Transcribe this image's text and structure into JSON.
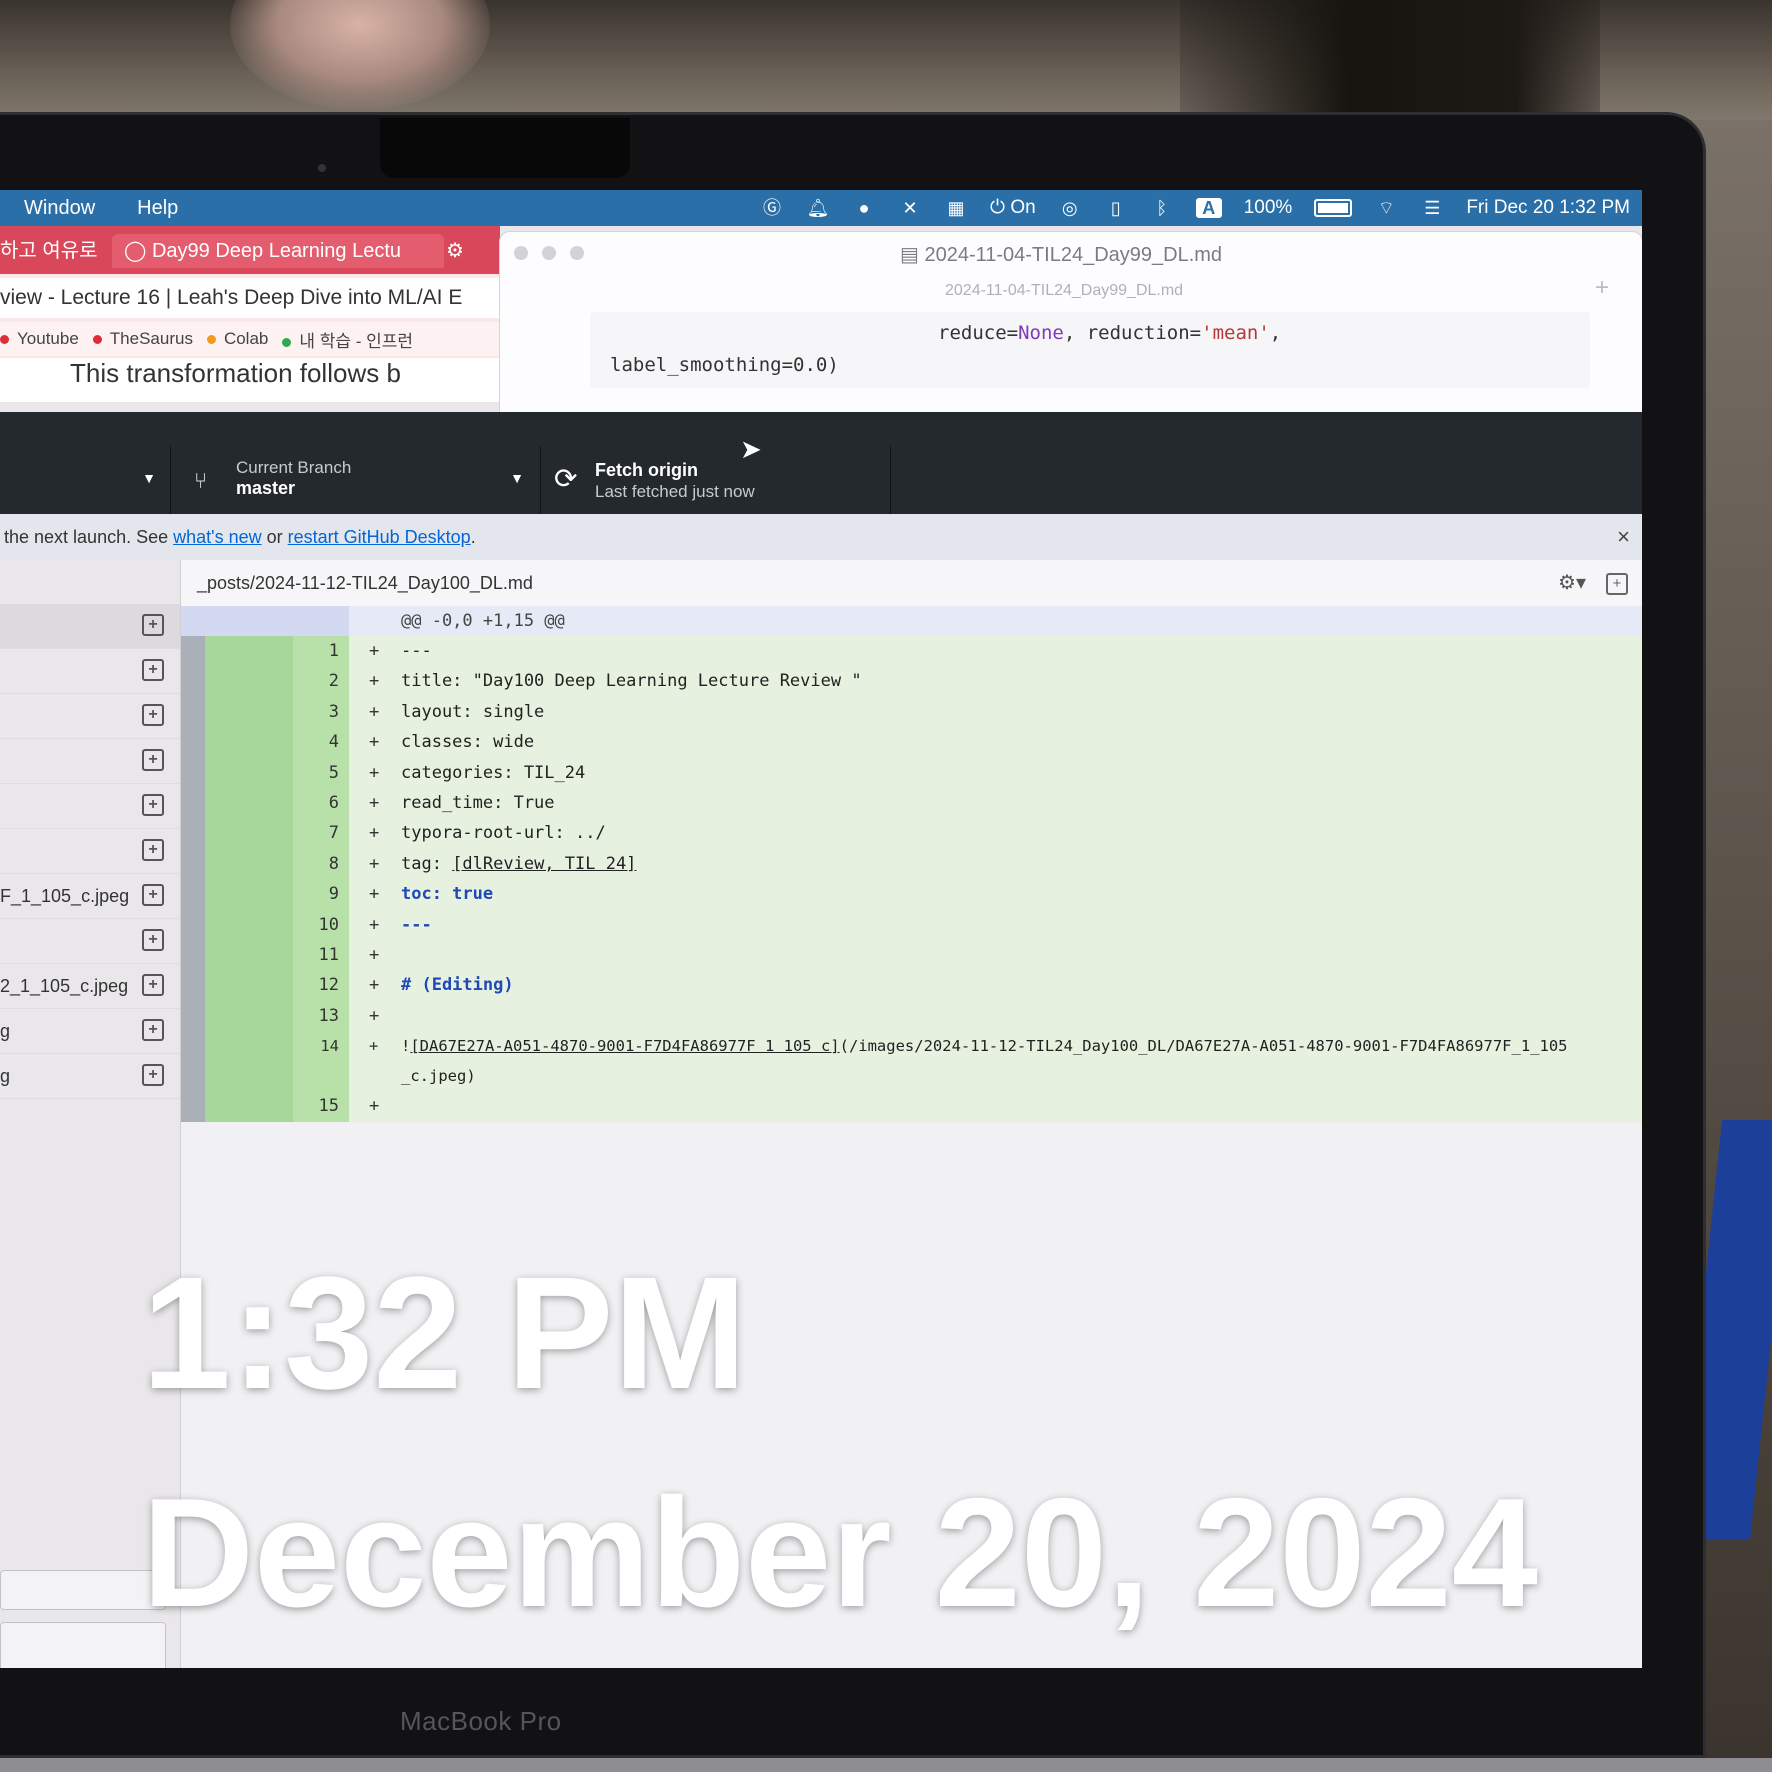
{
  "menubar": {
    "items": [
      "Window",
      "Help"
    ],
    "status": {
      "focus_label": "On",
      "input_source": "A",
      "battery": "100%",
      "datetime": "Fri Dec 20  1:32 PM"
    }
  },
  "browser": {
    "tabs": [
      "하고 여유로",
      "Day99 Deep Learning Lectu"
    ],
    "page_title": "view - Lecture 16 | Leah's Deep Dive into ML/AI E",
    "bookmarks": [
      {
        "label": "Youtube",
        "color": "#e02b3a"
      },
      {
        "label": "TheSaurus",
        "color": "#e02b3a"
      },
      {
        "label": "Colab",
        "color": "#f29a1f"
      },
      {
        "label": "내 학습 - 인프런",
        "color": "#2fa84f"
      }
    ],
    "body_text": "This transformation follows b"
  },
  "typora": {
    "title": "2024-11-04-TIL24_Day99_DL.md",
    "subtitle": "2024-11-04-TIL24_Day99_DL.md",
    "code_line1_a": "reduce=",
    "code_line1_b": "None",
    "code_line1_c": ", reduction=",
    "code_line1_d": "'mean'",
    "code_line1_e": ",",
    "code_line2": "label_smoothing=0.0)"
  },
  "github": {
    "current_branch_label": "Current Branch",
    "current_branch": "master",
    "fetch_label": "Fetch origin",
    "fetch_sub": "Last fetched just now",
    "banner_prefix": "the next launch. See ",
    "banner_link1": "what's new",
    "banner_mid": " or ",
    "banner_link2": "restart GitHub Desktop",
    "banner_suffix": ".",
    "file_path": "_posts/2024-11-12-TIL24_Day100_DL.md",
    "hunk_header": "@@ -0,0 +1,15 @@",
    "sidebar_files": [
      "",
      "",
      "",
      "",
      "",
      "",
      "F_1_105_c.jpeg",
      "",
      "2_1_105_c.jpeg",
      "g",
      "g"
    ],
    "diff_lines": [
      {
        "n": "1",
        "text": "---"
      },
      {
        "n": "2",
        "text": "title: \"Day100 Deep Learning Lecture Review \""
      },
      {
        "n": "3",
        "text": "layout: single"
      },
      {
        "n": "4",
        "text": "classes: wide"
      },
      {
        "n": "5",
        "text": "categories: TIL_24"
      },
      {
        "n": "6",
        "text": "read_time: True"
      },
      {
        "n": "7",
        "text": "typora-root-url: ../"
      },
      {
        "n": "8",
        "text_a": "tag: ",
        "link": "[dlReview, TIL 24]"
      },
      {
        "n": "9",
        "kw": "toc: true"
      },
      {
        "n": "10",
        "kw": "---"
      },
      {
        "n": "11",
        "text": ""
      },
      {
        "n": "12",
        "kw": "# (Editing)"
      },
      {
        "n": "13",
        "text": ""
      },
      {
        "n": "14",
        "text_a": "!",
        "link": "[DA67E27A-A051-4870-9001-F7D4FA86977F 1 105 c]",
        "text_b": "(/images/2024-11-12-TIL24_Day100_DL/DA67E27A-A051-4870-9001-F7D4FA86977F_1_105",
        "cont": "_c.jpeg)"
      },
      {
        "n": "15",
        "text": ""
      }
    ]
  },
  "overlay": {
    "time": "1:32 PM",
    "date": "December 20, 2024"
  },
  "device_label": "MacBook Pro"
}
